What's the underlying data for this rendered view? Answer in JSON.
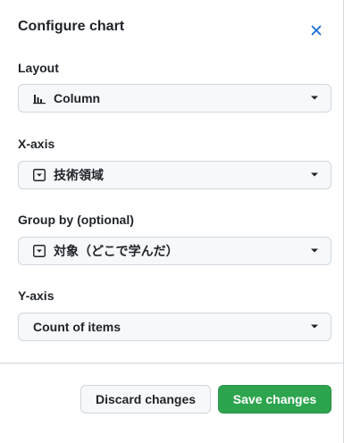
{
  "dialog": {
    "title": "Configure chart",
    "close_icon": "close-icon"
  },
  "layout": {
    "label": "Layout",
    "value": "Column",
    "icon": "column-chart-icon"
  },
  "x_axis": {
    "label": "X-axis",
    "value": "技術領域",
    "icon": "single-select-field-icon"
  },
  "group_by": {
    "label": "Group by (optional)",
    "value": "対象（どこで学んだ）",
    "icon": "single-select-field-icon"
  },
  "y_axis": {
    "label": "Y-axis",
    "value": "Count of items"
  },
  "footer": {
    "discard_label": "Discard changes",
    "save_label": "Save changes"
  },
  "colors": {
    "accent": "#0969da",
    "save_button": "#2da44e",
    "border": "#d0d7de",
    "field_background": "#f6f8fa"
  }
}
